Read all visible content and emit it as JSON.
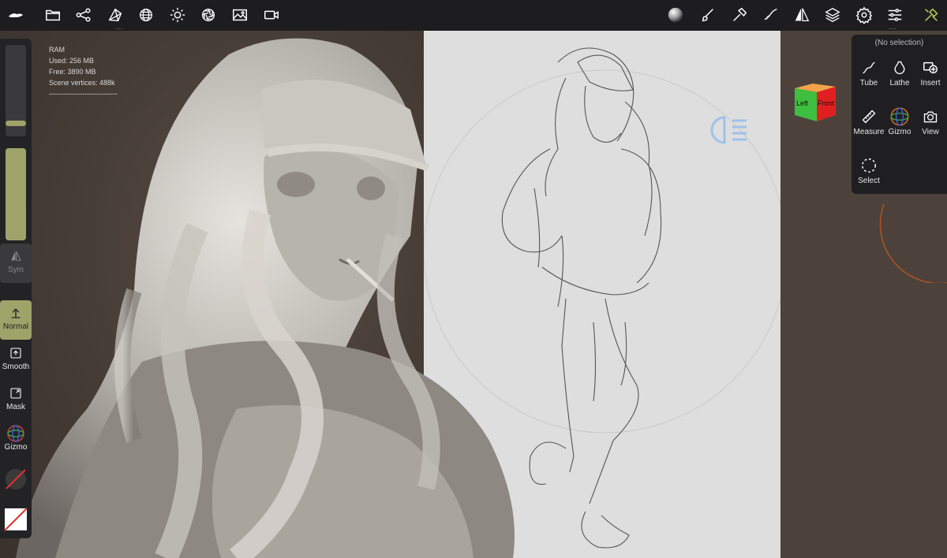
{
  "toolbar": {
    "left_icons": [
      "app-logo-icon",
      "folder-icon",
      "share-nodes-icon",
      "scene-mesh-icon",
      "wireframe-globe-icon",
      "sun-icon",
      "aperture-icon",
      "image-icon",
      "video-camera-icon"
    ],
    "right_icons": [
      "matcap-sphere-icon",
      "brush-icon",
      "hammer-icon",
      "stroke-paint-icon",
      "symmetry-icon",
      "layers-icon",
      "settings-gear-icon",
      "sliders-icon",
      "tools-icon"
    ]
  },
  "ram": {
    "title": "RAM",
    "used": "Used: 256 MB",
    "free": "Free: 3890 MB",
    "vertices": "Scene vertices: 488k",
    "divider": "-----------------------------"
  },
  "left_panel": {
    "radius_level": 0.12,
    "intensity_level": 1.0,
    "sym_label": "Sym",
    "normal_label": "Normal",
    "smooth_label": "Smooth",
    "mask_label": "Mask",
    "gizmo_label": "Gizmo"
  },
  "right_menu": {
    "title": "(No selection)",
    "items": [
      {
        "label": "Tube",
        "icon": "tube-curve-icon"
      },
      {
        "label": "Lathe",
        "icon": "lathe-vase-icon"
      },
      {
        "label": "Insert",
        "icon": "insert-plus-icon"
      },
      {
        "label": "Measure",
        "icon": "ruler-icon"
      },
      {
        "label": "Gizmo",
        "icon": "gizmo-axes-icon"
      },
      {
        "label": "View",
        "icon": "camera-icon"
      },
      {
        "label": "Select",
        "icon": "dashed-circle-icon"
      }
    ]
  },
  "viewcube": {
    "left": "Left",
    "front": "Front"
  },
  "colors": {
    "accent": "#9ea36a",
    "panel": "#232325",
    "cube_left": "#3fbf3f",
    "cube_front": "#e02020"
  }
}
